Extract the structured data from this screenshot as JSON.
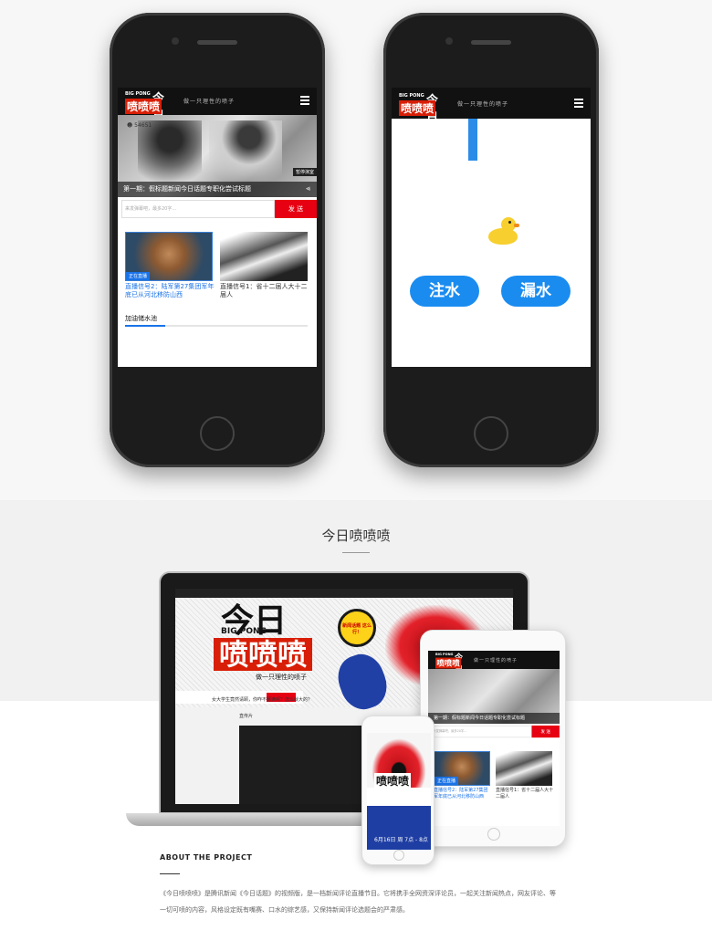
{
  "brand": {
    "big_pong": "BIG PONG",
    "logo_jin": "今日",
    "logo_pen": "喷喷喷",
    "slogan": "做一只理性的喷子"
  },
  "phone_left": {
    "views": "54651",
    "tag": "暂停演室",
    "caption": "第一期：假标题新闻今日话题专职化尝试标题",
    "input_placeholder": "来发弹幕吧，最多20字...",
    "send_label": "发 送",
    "items": [
      {
        "badge": "正在直播",
        "title": "直播信号2：陆军第27集团军年底已从河北移防山西"
      },
      {
        "badge": "",
        "title": "直播信号1：省十二届人大十二届人"
      }
    ],
    "section_title": "加油储水池"
  },
  "phone_right": {
    "button_inject": "注水",
    "button_leak": "漏水"
  },
  "showcase": {
    "title": "今日喷喷喷",
    "laptop_sub": "做一只理性的喷子",
    "laptop_bubble": "新闻话题 这么行！",
    "laptop_question": "女大学生竟然请颐，你咋不蹙满呢？怎么就大的？",
    "laptop_side": "直传片",
    "tablet_caption": "第一期：假标题新闻今日话题专职化尝试标题",
    "mini_date": "6月16日 周 7点 - 8点"
  },
  "about": {
    "heading": "ABOUT THE PROJECT",
    "text": "《今日喷喷喷》是腾讯新闻《今日话题》的视频版，是一档新闻评论直播节目。它将携手全网资深评论员，一起关注新闻热点，网友评论、等一切可喷的内容，风格设定既有嘴赛、口水的综艺感，又保持新闻评论选题会的严肃感。"
  },
  "colors": {
    "accent_red": "#e60012",
    "accent_blue": "#1a8cf0",
    "duck_yellow": "#f7cf2e"
  }
}
